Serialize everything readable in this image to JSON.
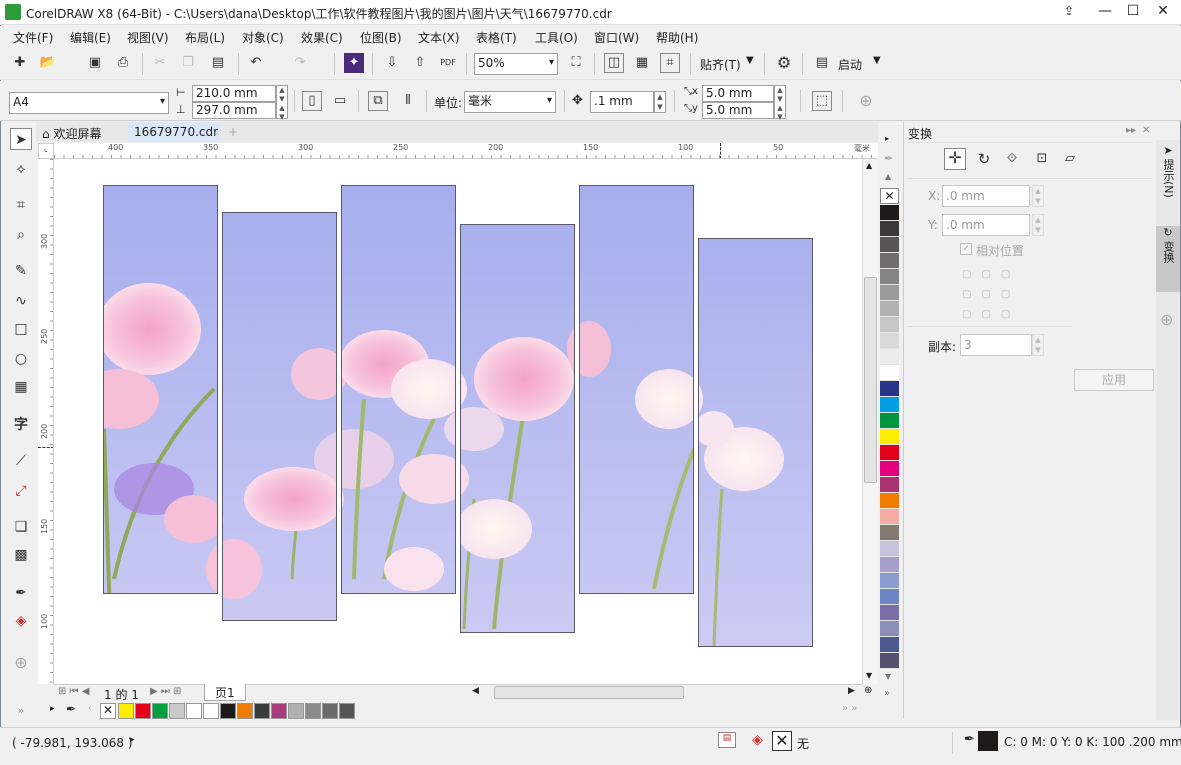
{
  "window": {
    "title": "CorelDRAW X8 (64-Bit) - C:\\Users\\dana\\Desktop\\工作\\软件教程图片\\我的图片\\图片\\天气\\16679770.cdr"
  },
  "menu": [
    "文件(F)",
    "编辑(E)",
    "视图(V)",
    "布局(L)",
    "对象(C)",
    "效果(C)",
    "位图(B)",
    "文本(X)",
    "表格(T)",
    "工具(O)",
    "窗口(W)",
    "帮助(H)"
  ],
  "toolbar": {
    "zoom": "50%",
    "snap_label": "贴齐(T)",
    "launch_label": "启动"
  },
  "propbar": {
    "page_size": "A4",
    "width": "210.0 mm",
    "height": "297.0 mm",
    "unit_label": "单位:",
    "unit": "毫米",
    "nudge": ".1 mm",
    "dup_x": "5.0 mm",
    "dup_y": "5.0 mm"
  },
  "tabs": [
    {
      "label": "欢迎屏幕"
    },
    {
      "label": "16679770.cdr"
    }
  ],
  "ruler_h": [
    "400",
    "350",
    "300",
    "250",
    "200",
    "150",
    "100",
    "50",
    "毫米"
  ],
  "ruler_v": [
    "300",
    "250",
    "200",
    "150",
    "100"
  ],
  "pagebar": {
    "page_count": "1 的 1",
    "page_tab": "页1"
  },
  "docker": {
    "title": "变换",
    "x_label": "X:",
    "x_value": ".0 mm",
    "y_label": "Y:",
    "y_value": ".0 mm",
    "relative": "相对位置",
    "copies_label": "副本:",
    "copies_value": "3",
    "apply": "应用"
  },
  "sidetabs": {
    "hints": "提示(N)",
    "transform": "变换"
  },
  "status": {
    "coords": "( -79.981, 193.068 )",
    "fill_none": "无",
    "outline": "C: 0 M: 0 Y: 0 K: 100  .200 mm"
  },
  "colors": {
    "sky_top": "#a3acec",
    "sky_bottom": "#c9c8f3",
    "accent_green": "#2e9b3a"
  }
}
